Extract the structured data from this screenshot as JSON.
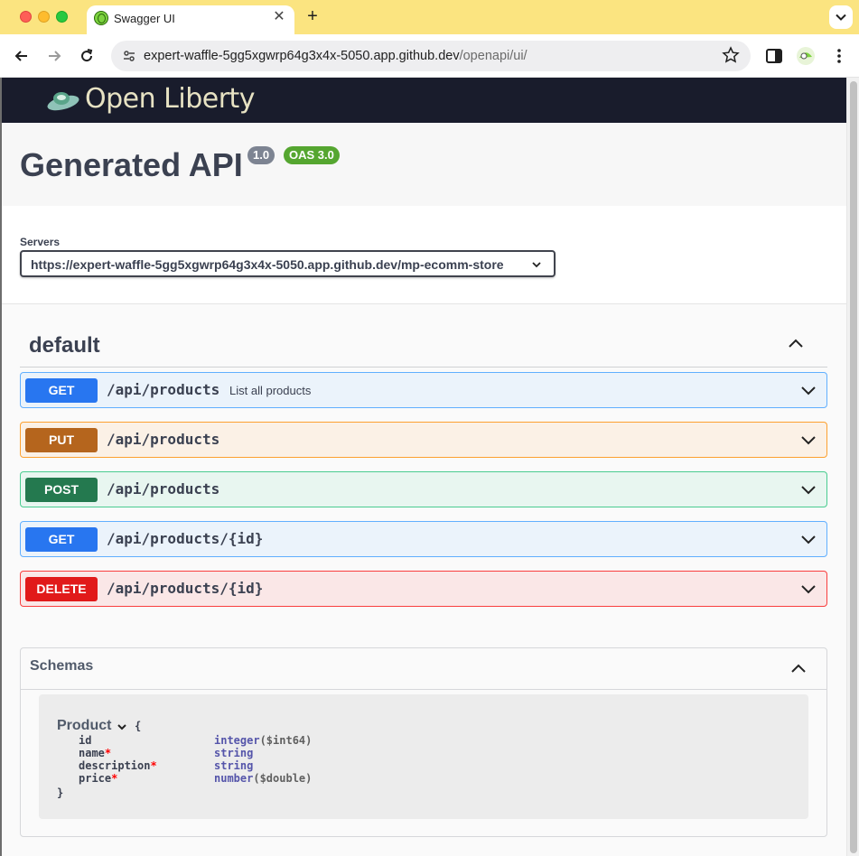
{
  "browser": {
    "tab_title": "Swagger UI",
    "url_host": "expert-waffle-5gg5xgwrp64g3x4x-5050.app.github.dev",
    "url_path": "/openapi/ui/"
  },
  "header": {
    "logo_text": "Open Liberty"
  },
  "info": {
    "title": "Generated API",
    "version": "1.0",
    "oas": "OAS 3.0"
  },
  "servers": {
    "label": "Servers",
    "selected": "https://expert-waffle-5gg5xgwrp64g3x4x-5050.app.github.dev/mp-ecomm-store"
  },
  "tag": {
    "name": "default"
  },
  "operations": [
    {
      "method": "GET",
      "path": "/api/products",
      "summary": "List all products"
    },
    {
      "method": "PUT",
      "path": "/api/products",
      "summary": ""
    },
    {
      "method": "POST",
      "path": "/api/products",
      "summary": ""
    },
    {
      "method": "GET",
      "path": "/api/products/{id}",
      "summary": ""
    },
    {
      "method": "DELETE",
      "path": "/api/products/{id}",
      "summary": ""
    }
  ],
  "schemas": {
    "title": "Schemas",
    "model": {
      "name": "Product",
      "open_brace": "{",
      "close_brace": "}",
      "properties": [
        {
          "name": "id",
          "required": "",
          "type": "integer",
          "format": "($int64)"
        },
        {
          "name": "name",
          "required": "*",
          "type": "string",
          "format": ""
        },
        {
          "name": "description",
          "required": "*",
          "type": "string",
          "format": ""
        },
        {
          "name": "price",
          "required": "*",
          "type": "number",
          "format": "($double)"
        }
      ]
    }
  },
  "colors": {
    "get": "#2876f0",
    "put": "#b5651d",
    "post": "#24794f",
    "delete": "#e11a1a",
    "header_bg": "#191c2c",
    "chrome_bar": "#fbe480"
  }
}
